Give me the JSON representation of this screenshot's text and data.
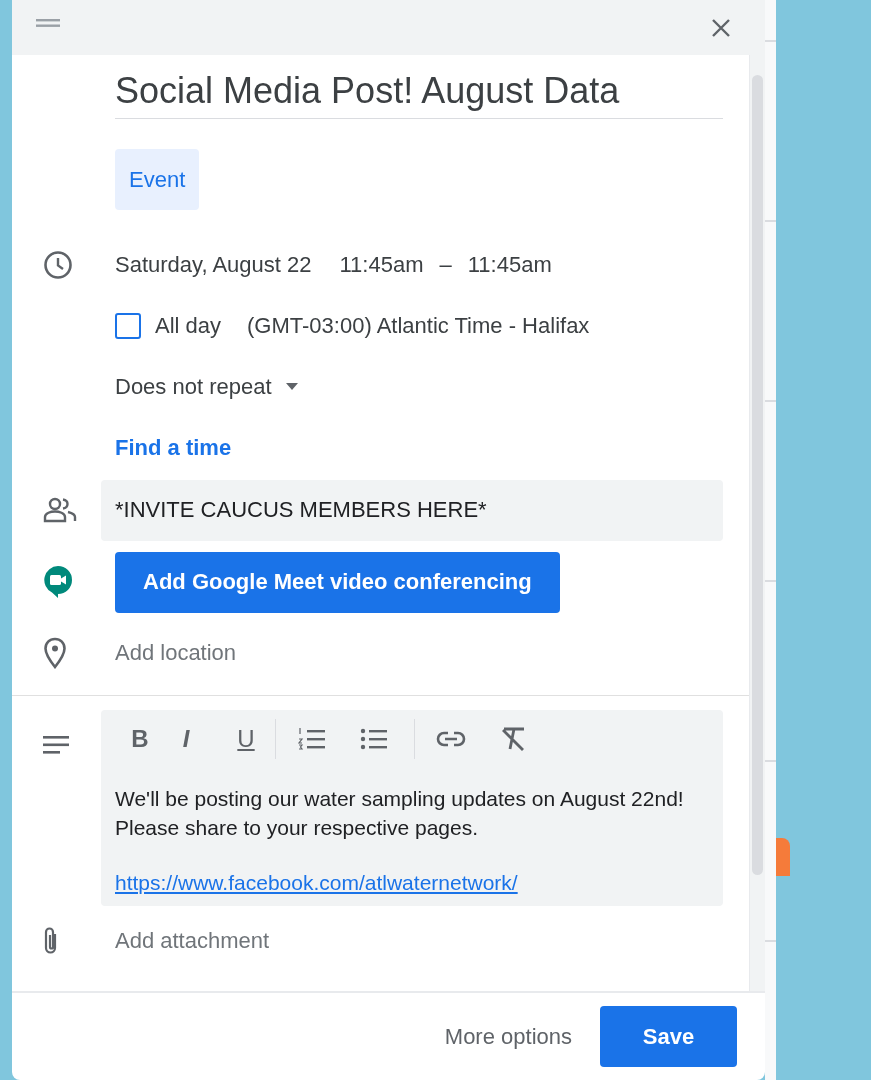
{
  "title": "Social Media Post! August Data",
  "tabs": [
    {
      "label": "Event",
      "selected": true
    }
  ],
  "date": "Saturday, August 22",
  "start_time": "11:45am",
  "time_separator": "–",
  "end_time": "11:45am",
  "all_day": {
    "label": "All day",
    "checked": false
  },
  "timezone": "(GMT-03:00) Atlantic Time - Halifax",
  "repeat": "Does not repeat",
  "find_time": "Find a time",
  "guests": {
    "value": "*INVITE CAUCUS MEMBERS HERE*"
  },
  "meet_button": "Add Google Meet video conferencing",
  "location": {
    "placeholder": "Add location"
  },
  "toolbar": [
    {
      "kind": "bold",
      "label": "B"
    },
    {
      "kind": "italic",
      "label": "I"
    },
    {
      "kind": "underline",
      "label": "U"
    },
    {
      "kind": "numbered-list"
    },
    {
      "kind": "bulleted-list"
    },
    {
      "kind": "link"
    },
    {
      "kind": "clear-format"
    }
  ],
  "description": {
    "text": "We'll be posting our water sampling updates on August 22nd! Please share to your respective pages.",
    "link": "https://www.facebook.com/atlwaternetwork/"
  },
  "attachment": {
    "placeholder": "Add attachment"
  },
  "more_options": "More options",
  "save": "Save"
}
